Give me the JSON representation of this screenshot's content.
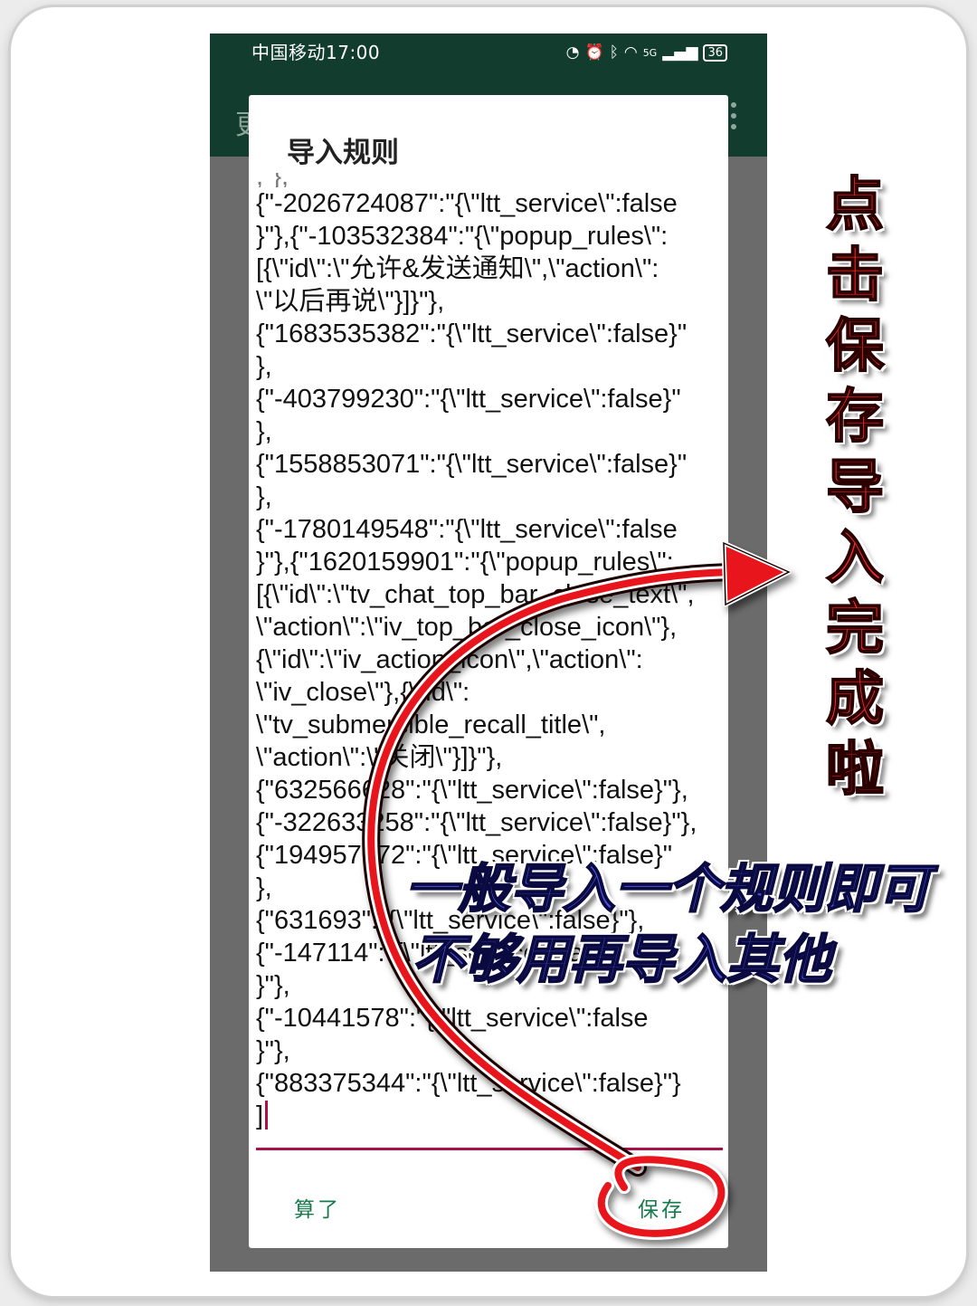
{
  "status_bar": {
    "carrier_time": "中国移动17:00",
    "icons": [
      "speed-icon",
      "alarm-icon",
      "bluetooth-icon",
      "wifi-icon",
      "5g-signal-icon"
    ],
    "network": "5G",
    "battery": "36"
  },
  "app_bar": {
    "title_peek": "更"
  },
  "dialog": {
    "title": "导入规则",
    "editor_lines": [
      ",\"},",
      "{\"-2026724087\":\"{\\\"ltt_service\\\":false",
      "}\"},{\"-103532384\":\"{\\\"popup_rules\\\":",
      "[{\\\"id\\\":\\\"允许&发送通知\\\",\\\"action\\\":",
      "\\\"以后再说\\\"}]}\"},",
      "{\"1683535382\":\"{\\\"ltt_service\\\":false}\"",
      "},",
      "{\"-403799230\":\"{\\\"ltt_service\\\":false}\"",
      "},",
      "{\"1558853071\":\"{\\\"ltt_service\\\":false}\"",
      "},",
      "{\"-1780149548\":\"{\\\"ltt_service\\\":false",
      "}\"},{\"1620159901\":\"{\\\"popup_rules\\\":",
      "[{\\\"id\\\":\\\"tv_chat_top_bar_close_text\\\",",
      "\\\"action\\\":\\\"iv_top_bar_close_icon\\\"},",
      "{\\\"id\\\":\\\"iv_action_icon\\\",\\\"action\\\":",
      "\\\"iv_close\\\"},{\\\"id\\\":",
      "\\\"tv_submersible_recall_title\\\",",
      "\\\"action\\\":\\\"关闭\\\"}]}\"},",
      "{\"632566628\":\"{\\\"ltt_service\\\":false}\"},",
      "{\"-322633258\":\"{\\\"ltt_service\\\":false}\"},",
      "{\"194957072\":\"{\\\"ltt_service\\\":false}\"",
      "},",
      "{\"631693\":\"{\\\"ltt_service\\\":false}\"},",
      "{\"-147114\":\"{\\\"ltt_service\\\":false",
      "}\"},",
      "{\"-10441578\":\"{\\\"ltt_service\\\":false",
      "}\"},",
      "{\"883375344\":\"{\\\"ltt_service\\\":false}\"}",
      "]"
    ],
    "cancel_label": "算了",
    "save_label": "保存"
  },
  "annotations": {
    "vertical_caption": [
      "点",
      "击",
      "保",
      "存",
      "导",
      "入",
      "完",
      "成",
      "啦"
    ],
    "caption_line1": "一般导入一个规则即可",
    "caption_line2": "不够用再导入其他",
    "arrow_color": "#e8141c",
    "circle_color": "#e8141c"
  },
  "colors": {
    "app_bar": "#123d2e",
    "accent_button": "#177a4d",
    "editor_underline": "#a8124b",
    "vertical_caption": "#f52c2c",
    "blue_caption": "#4a55e0"
  }
}
